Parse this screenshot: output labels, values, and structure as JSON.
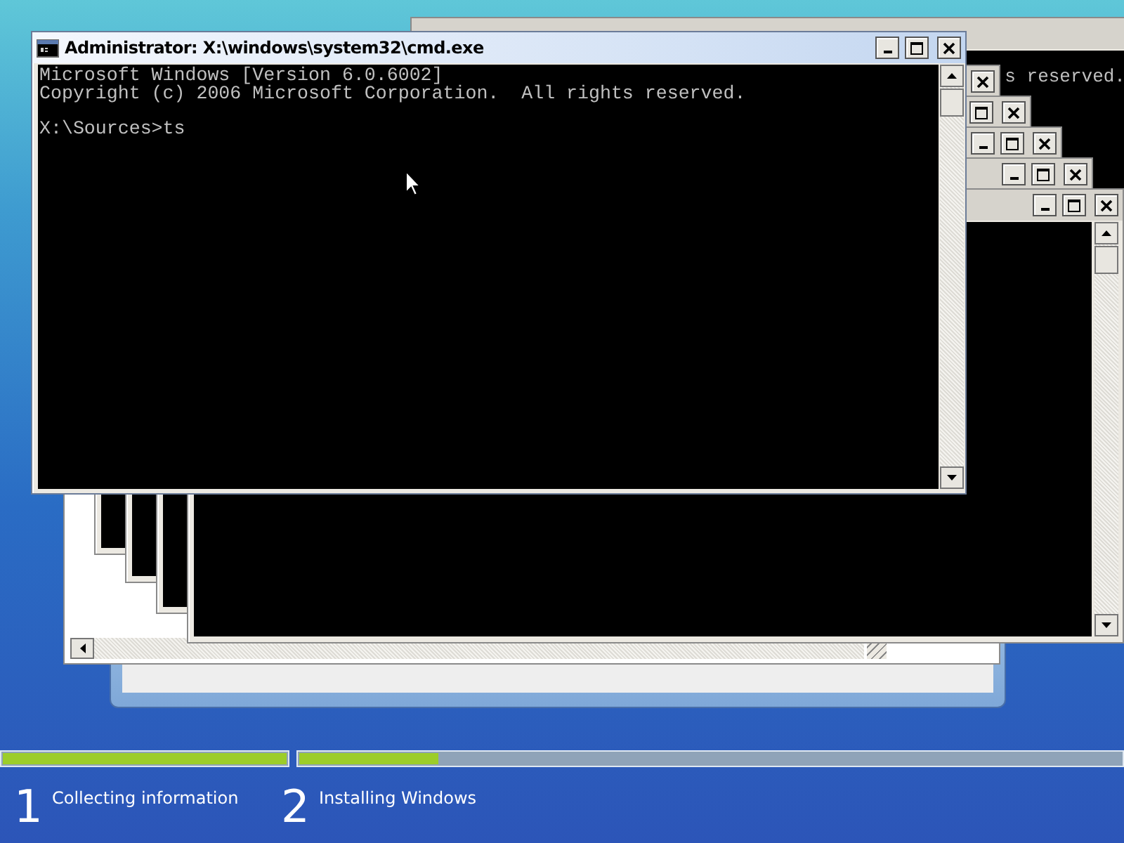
{
  "main_window": {
    "title": "Administrator: X:\\windows\\system32\\cmd.exe",
    "output": [
      "Microsoft Windows [Version 6.0.6002]",
      "Copyright (c) 2006 Microsoft Corporation.  All rights reserved."
    ],
    "prompt": "X:\\Sources>ts"
  },
  "background_window": {
    "text": "s reserved."
  },
  "steps": [
    {
      "number": "1",
      "label": "Collecting information",
      "level": 1
    },
    {
      "number": "2",
      "label": "Installing Windows",
      "level": 0.17
    }
  ]
}
